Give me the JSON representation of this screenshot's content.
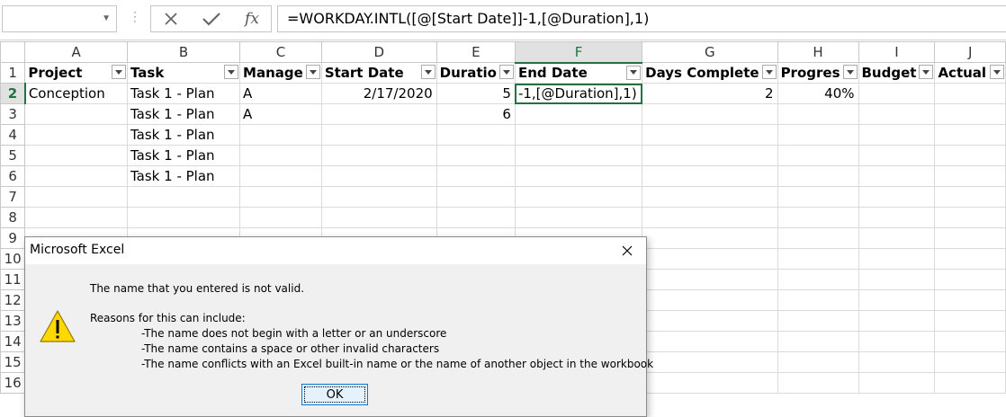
{
  "formula_bar": {
    "name_box": "",
    "formula": "=WORKDAY.INTL([@[Start Date]]-1,[@Duration],1)",
    "fx_label": "fx"
  },
  "columns": [
    "A",
    "B",
    "C",
    "D",
    "E",
    "F",
    "G",
    "H",
    "I",
    "J"
  ],
  "rows": [
    "1",
    "2",
    "3",
    "4",
    "5",
    "6",
    "7",
    "8",
    "9",
    "10",
    "11",
    "12",
    "13",
    "14",
    "15",
    "16"
  ],
  "headers": [
    "Project",
    "Task",
    "Manage",
    "Start Date",
    "Duratio",
    "End Date",
    "Days Complete",
    "Progres",
    "Budget",
    "Actual"
  ],
  "data": [
    [
      "Conception",
      "Task 1 - Plan",
      "A",
      "2/17/2020",
      "5",
      "-1,[@Duration],1)",
      "2",
      "40%",
      "",
      ""
    ],
    [
      "",
      "Task 1 - Plan",
      "A",
      "",
      "6",
      "",
      "",
      "",
      "",
      ""
    ],
    [
      "",
      "Task 1 - Plan",
      "",
      "",
      "",
      "",
      "",
      "",
      "",
      ""
    ],
    [
      "",
      "Task 1 - Plan",
      "",
      "",
      "",
      "",
      "",
      "",
      "",
      ""
    ],
    [
      "",
      "Task 1 - Plan",
      "",
      "",
      "",
      "",
      "",
      "",
      "",
      ""
    ]
  ],
  "dialog": {
    "title": "Microsoft Excel",
    "message": "The name that you entered is not valid.",
    "reasons_intro": "Reasons for this can include:",
    "reasons": [
      "-The name does not begin with a letter or an underscore",
      "-The name contains a space or other invalid characters",
      "-The name conflicts with an Excel built-in name or the name of another object in the workbook"
    ],
    "ok_label": "OK"
  },
  "colors": {
    "accent": "#217346",
    "warning": "#ffd800"
  }
}
